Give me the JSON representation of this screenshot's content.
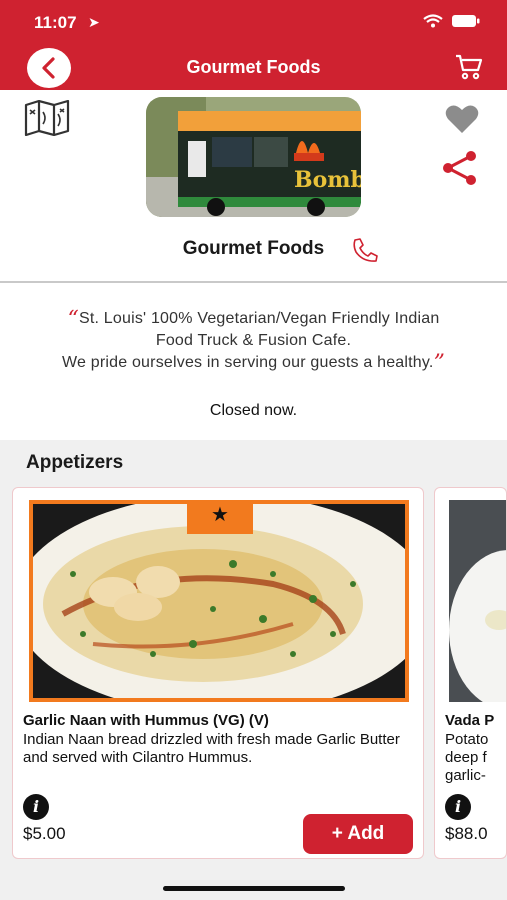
{
  "status_bar": {
    "time": "11:07",
    "location_glyph": "➤"
  },
  "nav": {
    "title": "Gourmet Foods",
    "back_icon": "chevron-left-icon",
    "cart_icon": "cart-icon"
  },
  "vendor": {
    "name": "Gourmet Foods",
    "description_line1": "St. Louis' 100% Vegetarian/Vegan Friendly  Indian",
    "description_line2": "Food Truck  & Fusion Cafe.",
    "description_line3": "We pride ourselves in serving our guests a healthy.",
    "open_status": "Closed now.",
    "quote_open": "“",
    "quote_close": "”",
    "truck_sign": "Bomba"
  },
  "menu": {
    "section_title": "Appetizers",
    "items": [
      {
        "name": "Garlic Naan with Hummus (VG) (V)",
        "description": "Indian Naan bread drizzled with fresh made Garlic Butter and served with Cilantro Hummus.",
        "price": "$5.00",
        "badge": "★",
        "info": "i",
        "add_label": "+ Add"
      },
      {
        "name": "Vada P",
        "description_line1": "Potato",
        "description_line2": "deep f",
        "description_line3": "garlic-",
        "price": "$88.0",
        "info": "i"
      }
    ]
  },
  "colors": {
    "brand_red": "#cf2230",
    "badge_orange": "#f27a1e"
  }
}
